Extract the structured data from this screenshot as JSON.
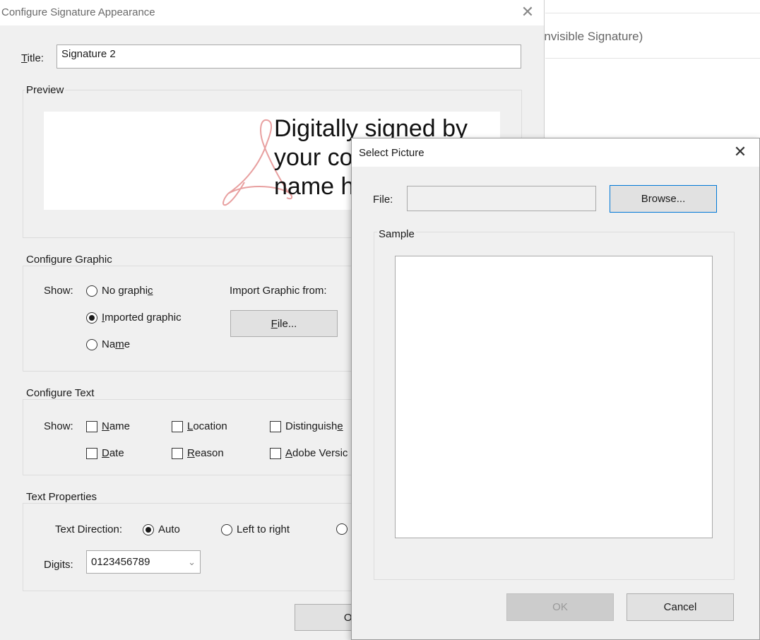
{
  "background_window": {
    "text": "(Invisible Signature)"
  },
  "main_dialog": {
    "title": "Configure Signature Appearance",
    "close_glyph": "✕",
    "title_field": {
      "label_prefix": "T",
      "label_rest": "itle:",
      "value": "Signature 2"
    },
    "preview": {
      "group_label": "Preview",
      "text": "Digitally signed by\nyour co\nname h"
    },
    "configure_graphic": {
      "group_label": "Configure Graphic",
      "show_label": "Show:",
      "options": [
        {
          "pre": "No graphi",
          "ul": "c",
          "post": "",
          "checked": false
        },
        {
          "pre": "",
          "ul": "I",
          "post": "mported graphic",
          "checked": true
        },
        {
          "pre": "Na",
          "ul": "m",
          "post": "e",
          "checked": false
        }
      ],
      "import_label": "Import Graphic from:",
      "file_button": {
        "ul": "F",
        "post": "ile..."
      }
    },
    "configure_text": {
      "group_label": "Configure Text",
      "show_label": "Show:",
      "checkboxes": [
        {
          "pre": "",
          "ul": "N",
          "post": "ame",
          "checked": false
        },
        {
          "pre": "",
          "ul": "L",
          "post": "ocation",
          "checked": false
        },
        {
          "pre": "Distinguish",
          "ul": "e",
          "post": "",
          "checked": false
        },
        {
          "pre": "",
          "ul": "D",
          "post": "ate",
          "checked": false
        },
        {
          "pre": "",
          "ul": "R",
          "post": "eason",
          "checked": false
        },
        {
          "pre": "",
          "ul": "A",
          "post": "dobe Versic",
          "checked": false
        }
      ]
    },
    "text_properties": {
      "group_label": "Text Properties",
      "direction_label": "Text Direction:",
      "direction_options": [
        {
          "label": "Auto",
          "checked": true
        },
        {
          "label": "Left to right",
          "checked": false
        },
        {
          "label": "",
          "checked": false
        }
      ],
      "digits_label": "Digits:",
      "digits_value": "0123456789",
      "dropdown_glyph": "⌄"
    },
    "ok_button_partial": "Ok"
  },
  "select_picture_dialog": {
    "title": "Select Picture",
    "close_glyph": "✕",
    "file_label": "File:",
    "file_value": "",
    "browse_button": "Browse...",
    "sample_label": "Sample",
    "ok_button": "OK",
    "cancel_button": "Cancel"
  },
  "colors": {
    "dialog_bg": "#f0f0f0",
    "adobe_logo": "#e8a0a0"
  }
}
